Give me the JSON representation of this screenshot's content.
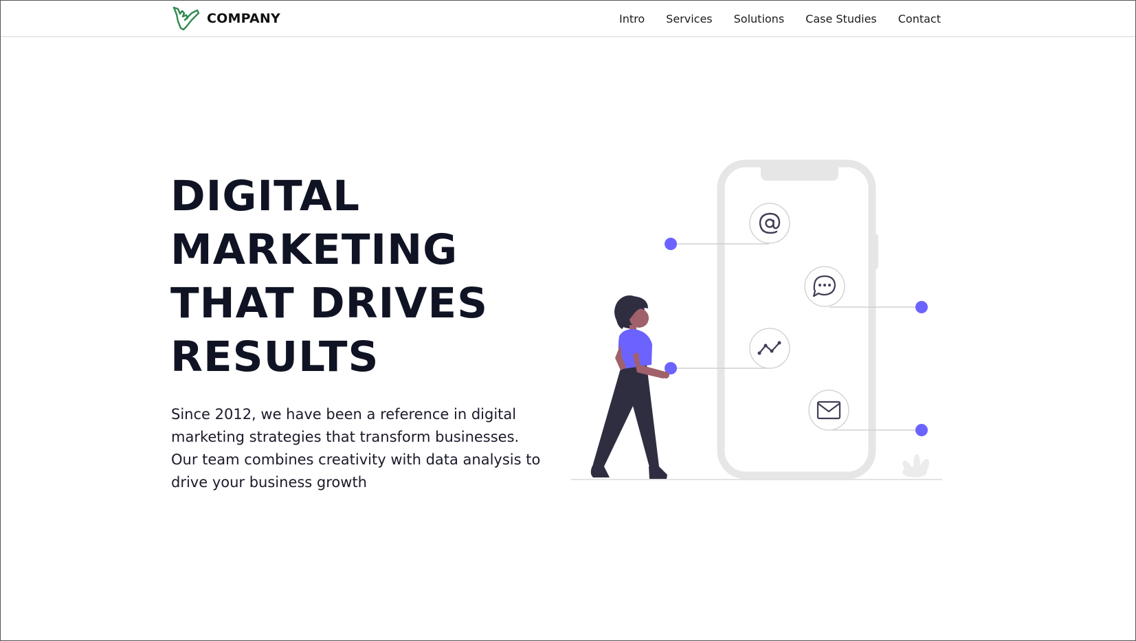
{
  "brand": {
    "name": "COMPANY",
    "logo_icon": "shaka-hand-icon",
    "logo_color": "#2e8b4f"
  },
  "nav": {
    "items": [
      {
        "label": "Intro"
      },
      {
        "label": "Services"
      },
      {
        "label": "Solutions"
      },
      {
        "label": "Case Studies"
      },
      {
        "label": "Contact"
      }
    ]
  },
  "hero": {
    "title_lines": [
      "DIGITAL",
      "MARKETING",
      "THAT DRIVES",
      "RESULTS"
    ],
    "description": "Since 2012, we have been a reference in digital marketing strategies that transform businesses. Our team combines creativity with data analysis to drive your business growth"
  },
  "illustration": {
    "accent_color": "#6c63ff",
    "phone_color": "#e6e6e6",
    "icons": [
      "at-sign-icon",
      "chat-bubble-icon",
      "trend-line-icon",
      "envelope-icon"
    ]
  }
}
